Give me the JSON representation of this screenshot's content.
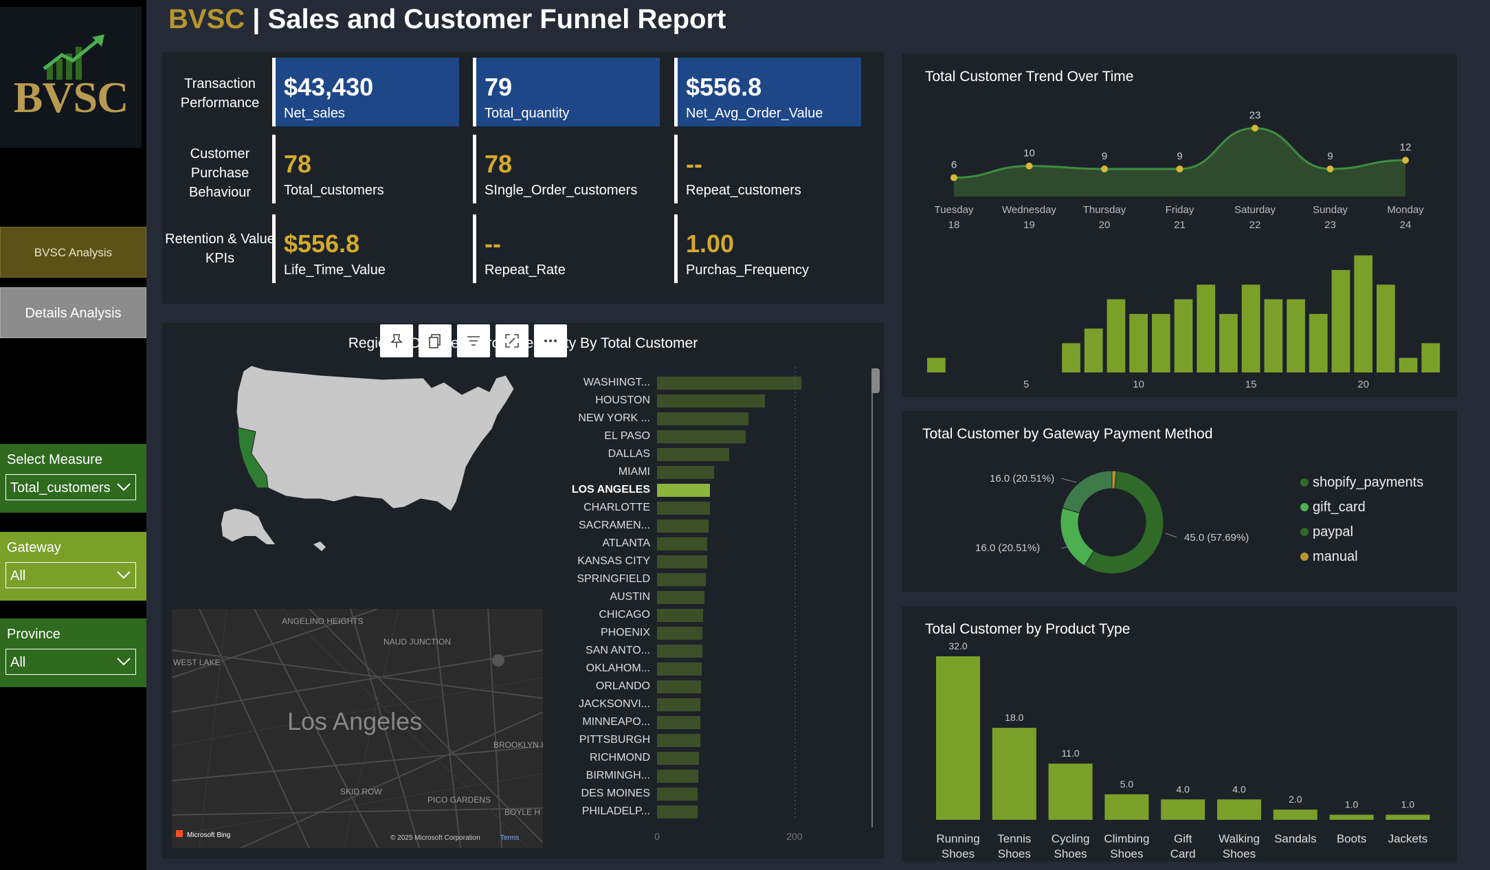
{
  "sidebar": {
    "logo_text": "BVSC",
    "nav": {
      "bvsc_analysis": "BVSC Analysis",
      "details_analysis": "Details Analysis"
    },
    "slicers": {
      "measure": {
        "label": "Select Measure",
        "value": "Total_customers"
      },
      "gateway": {
        "label": "Gateway",
        "value": "All"
      },
      "province": {
        "label": "Province",
        "value": "All"
      }
    }
  },
  "header": {
    "brand": "BVSC",
    "separator": " | ",
    "title": "Sales and Customer Funnel Report"
  },
  "kpi": {
    "rows": [
      "Transaction Performance",
      "Customer Purchase Behaviour",
      "Retention & Value KPIs"
    ],
    "cards": [
      {
        "value": "$43,430",
        "label": "Net_sales"
      },
      {
        "value": "79",
        "label": "Total_quantity"
      },
      {
        "value": "$556.8",
        "label": "Net_Avg_Order_Value"
      },
      {
        "value": "78",
        "label": "Total_customers"
      },
      {
        "value": "78",
        "label": "SIngle_Order_customers"
      },
      {
        "value": "--",
        "label": "Repeat_customers"
      },
      {
        "value": "$556.8",
        "label": "Life_Time_Value"
      },
      {
        "value": "--",
        "label": "Repeat_Rate"
      },
      {
        "value": "1.00",
        "label": "Purchas_Frequency"
      }
    ],
    "colors": {
      "card_blue": "#1e4788",
      "gold_value": "#d4aa2c"
    }
  },
  "region": {
    "title": "Regional Overview: Province & City By Total Customer",
    "map_labels": [
      "ANGELINO HEIGHTS",
      "NAUD JUNCTION",
      "WEST LAKE",
      "Los Angeles",
      "BROOKLYN HEIGHTS",
      "SKID ROW",
      "PICO GARDENS",
      "BOYLE H"
    ],
    "map_footer": {
      "provider": "Microsoft Bing",
      "copyright": "© 2025 Microsoft Corporation",
      "terms": "Terms"
    },
    "highlight_color": "#2e7d32"
  },
  "chart_data": [
    {
      "type": "line",
      "title": "Total Customer Trend Over Time",
      "x": [
        "Tuesday 18",
        "Wednesday 19",
        "Thursday 20",
        "Friday 21",
        "Saturday 22",
        "Sunday 23",
        "Monday 24"
      ],
      "x_day": [
        "Tuesday",
        "Wednesday",
        "Thursday",
        "Friday",
        "Saturday",
        "Sunday",
        "Monday"
      ],
      "x_num": [
        "18",
        "19",
        "20",
        "21",
        "22",
        "23",
        "24"
      ],
      "values": [
        6,
        10,
        9,
        9,
        23,
        9,
        12
      ]
    },
    {
      "type": "bar",
      "title": "",
      "x": [
        1,
        2,
        3,
        4,
        5,
        6,
        7,
        8,
        9,
        10,
        11,
        12,
        13,
        14,
        15,
        16,
        17,
        18,
        19,
        20,
        21,
        22,
        23
      ],
      "values": [
        1,
        0,
        0,
        0,
        0,
        0,
        2,
        3,
        5,
        4,
        4,
        5,
        6,
        4,
        6,
        5,
        5,
        4,
        7,
        8,
        6,
        1,
        2
      ],
      "xticks": [
        5,
        10,
        15,
        20
      ]
    },
    {
      "type": "pie",
      "title": "Total Customer by Gateway Payment Method",
      "categories": [
        "shopify_payments",
        "gift_card",
        "paypal",
        "manual"
      ],
      "values": [
        45.0,
        16.0,
        16.0,
        1.0
      ],
      "labels": [
        "45.0 (57.69%)",
        "16.0 (20.51%)",
        "16.0 (20.51%)",
        ""
      ],
      "colors": [
        "#2f6a28",
        "#4caf50",
        "#3f7a4a",
        "#b7962f"
      ]
    },
    {
      "type": "bar",
      "title": "Total Customer by Product Type",
      "categories": [
        "Running Shoes",
        "Tennis Shoes",
        "Cycling Shoes",
        "Climbing Shoes",
        "Gift Card",
        "Walking Shoes",
        "Sandals",
        "Boots",
        "Jackets"
      ],
      "values": [
        32.0,
        18.0,
        11.0,
        5.0,
        4.0,
        4.0,
        2.0,
        1.0,
        1.0
      ],
      "value_labels": [
        "32.0",
        "18.0",
        "11.0",
        "5.0",
        "4.0",
        "4.0",
        "2.0",
        "1.0",
        "1.0"
      ]
    },
    {
      "type": "bar",
      "title": "",
      "orientation": "horizontal",
      "categories": [
        "WASHINGT...",
        "HOUSTON",
        "NEW YORK ...",
        "EL PASO",
        "DALLAS",
        "MIAMI",
        "LOS ANGELES",
        "CHARLOTTE",
        "SACRAMEN...",
        "ATLANTA",
        "KANSAS CITY",
        "SPRINGFIELD",
        "AUSTIN",
        "CHICAGO",
        "PHOENIX",
        "SAN ANTO...",
        "OKLAHOM...",
        "ORLANDO",
        "JACKSONVI...",
        "MINNEAPO...",
        "PITTSBURGH",
        "RICHMOND",
        "BIRMINGH...",
        "DES MOINES",
        "PHILADELP..."
      ],
      "values": [
        210,
        157,
        133,
        129,
        105,
        83,
        77,
        77,
        75,
        73,
        73,
        71,
        69,
        67,
        66,
        66,
        65,
        64,
        63,
        63,
        63,
        61,
        60,
        59,
        59
      ],
      "selected": "LOS ANGELES",
      "xticks": [
        0,
        200
      ],
      "xlim": [
        0,
        300
      ]
    }
  ]
}
